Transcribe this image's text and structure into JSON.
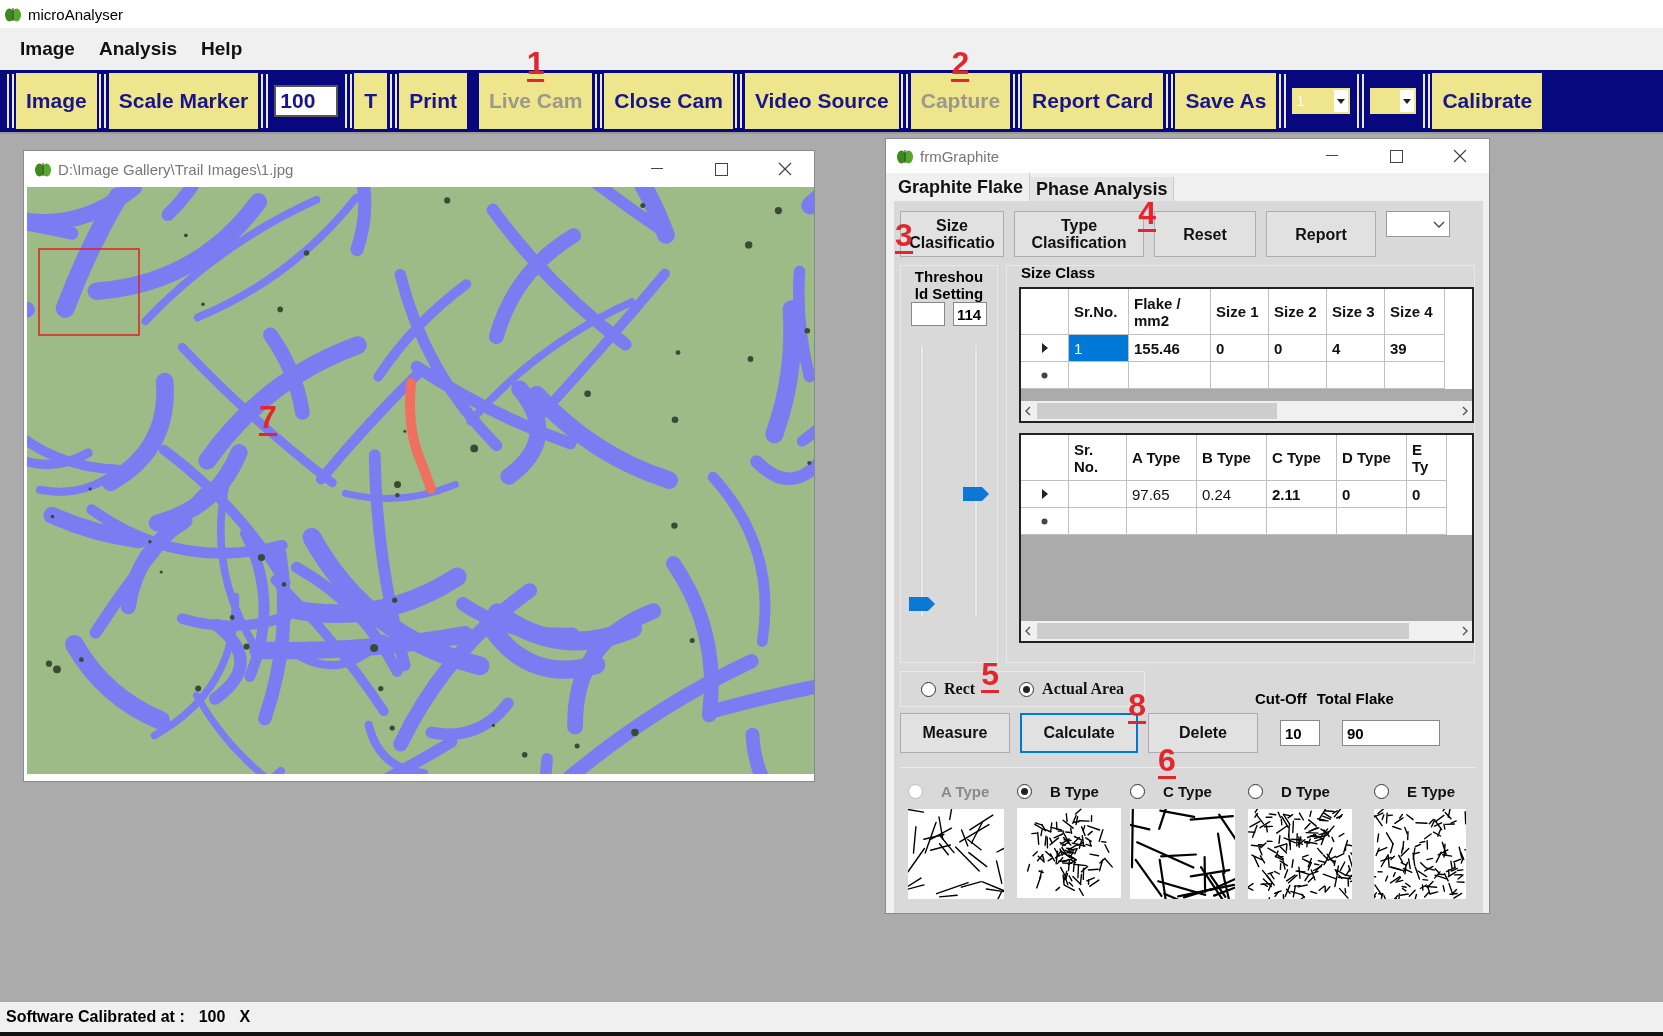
{
  "app": {
    "title": "microAnalyser"
  },
  "menu": [
    {
      "label": "Image"
    },
    {
      "label": "Analysis"
    },
    {
      "label": "Help"
    }
  ],
  "toolbar": [
    {
      "kind": "button",
      "label": "Image",
      "disabled": false
    },
    {
      "kind": "button",
      "label": "Scale Marker",
      "disabled": false
    },
    {
      "kind": "field",
      "value": "100"
    },
    {
      "kind": "button",
      "label": "T",
      "disabled": false
    },
    {
      "kind": "button",
      "label": "Print",
      "disabled": false
    },
    {
      "kind": "button",
      "label": "Live Cam",
      "disabled": true,
      "callout": "1"
    },
    {
      "kind": "button",
      "label": "Close Cam",
      "disabled": false
    },
    {
      "kind": "button",
      "label": "Video Source",
      "disabled": false
    },
    {
      "kind": "button",
      "label": "Capture",
      "disabled": true,
      "callout": "2"
    },
    {
      "kind": "button",
      "label": "Report Card",
      "disabled": false
    },
    {
      "kind": "button",
      "label": "Save As",
      "disabled": false
    },
    {
      "kind": "dropdown",
      "value": "1"
    },
    {
      "kind": "dropdown"
    },
    {
      "kind": "button",
      "label": "Calibrate",
      "disabled": false
    }
  ],
  "image_window": {
    "title": "D:\\Image Gallery\\Trail Images\\1.jpg",
    "callout": "7"
  },
  "graphite_window": {
    "title": "frmGraphite",
    "tabs": [
      {
        "label": "Graphite Flake",
        "selected": true
      },
      {
        "label": "Phase Analysis",
        "selected": false
      }
    ],
    "buttons": [
      {
        "label": "Size Clasificatio",
        "callout": "3"
      },
      {
        "label": "Type Clasification",
        "callout": "4"
      },
      {
        "label": "Reset"
      },
      {
        "label": "Report"
      }
    ],
    "threshold": {
      "label_lines": [
        "Threshou",
        "ld Setting"
      ],
      "field_2": "114",
      "sliders": [
        {
          "level": 0.02
        },
        {
          "level": 0.45
        }
      ]
    },
    "size_class": {
      "title": "Size Class",
      "columns": [
        "Sr.No.",
        "Flake / mm2",
        "Size 1",
        "Size 2",
        "Size 3",
        "Size 4"
      ],
      "rows": [
        {
          "cells": [
            {
              "text": "1",
              "selected": true
            },
            {
              "text": "155.46",
              "selected": false
            },
            {
              "text": "0",
              "selected": false
            },
            {
              "text": "0",
              "selected": false
            },
            {
              "text": "4",
              "selected": false
            },
            {
              "text": "39",
              "selected": false
            }
          ]
        }
      ]
    },
    "type_class": {
      "columns": [
        "Sr. No.",
        "A Type",
        "B Type",
        "C Type",
        "D Type",
        "E Ty"
      ],
      "rows": [
        {
          "cells": [
            null,
            "97.65",
            "0.24",
            "2.11",
            "0",
            "0"
          ]
        }
      ]
    },
    "area_mode": [
      {
        "label": "Rect",
        "selected": false,
        "callout": "5"
      },
      {
        "label": "Actual Area",
        "selected": true
      }
    ],
    "cut_off": {
      "label": "Cut-Off",
      "value": "10"
    },
    "total_flake": {
      "label": "Total Flake",
      "value": "90"
    },
    "actions": [
      {
        "label": "Measure",
        "focused": false
      },
      {
        "label": "Calculate",
        "focused": true,
        "callout": "8"
      },
      {
        "label": "Delete",
        "focused": false
      }
    ],
    "flake_types": [
      {
        "label": "A Type",
        "selected": false,
        "disabled": true
      },
      {
        "label": "B Type",
        "selected": true,
        "disabled": false
      },
      {
        "label": "C Type",
        "selected": false,
        "disabled": false,
        "callout": "6"
      },
      {
        "label": "D Type",
        "selected": false,
        "disabled": false
      },
      {
        "label": "E Type",
        "selected": false,
        "disabled": false
      }
    ]
  },
  "status_bar": {
    "label": "Software Calibrated at :",
    "value": "100",
    "unit": "X"
  }
}
